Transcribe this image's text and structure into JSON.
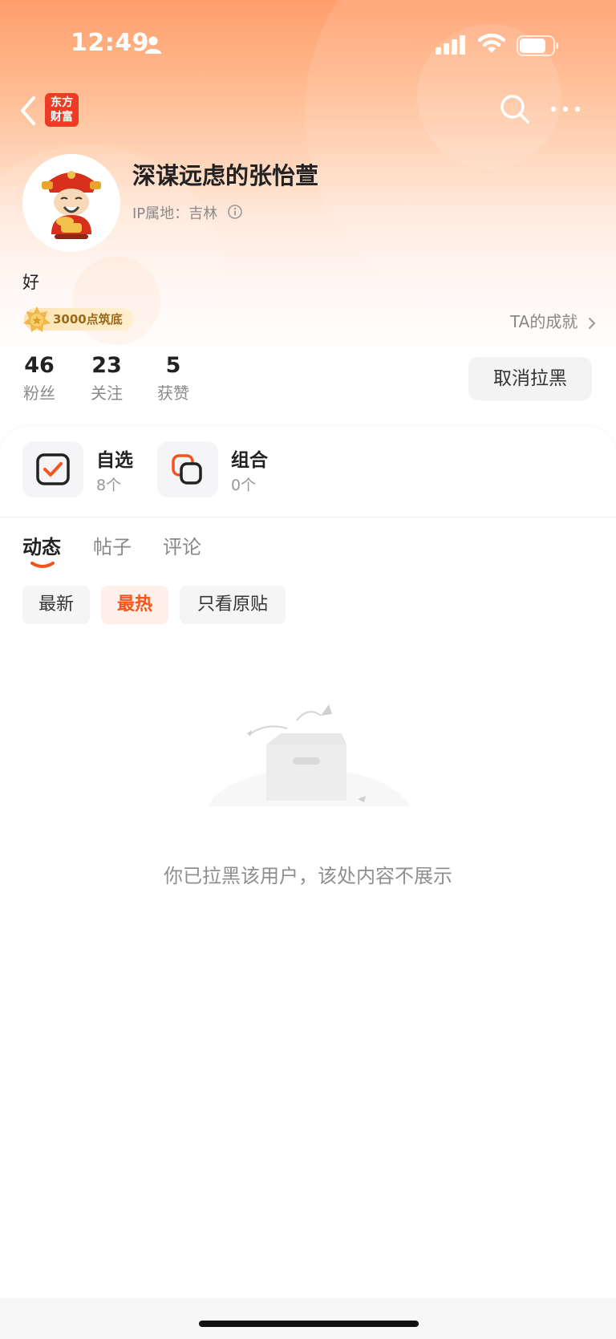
{
  "status_bar": {
    "time": "12:49"
  },
  "nav": {
    "logo_line1": "东方",
    "logo_line2": "财富"
  },
  "profile": {
    "username": "深谋远虑的张怡萱",
    "ip_location": "IP属地：吉林",
    "bio": "好",
    "badge": "3000点筑底",
    "achievement_link": "TA的成就",
    "stats": [
      {
        "value": "46",
        "label": "粉丝"
      },
      {
        "value": "23",
        "label": "关注"
      },
      {
        "value": "5",
        "label": "获赞"
      }
    ],
    "unblock_button": "取消拉黑"
  },
  "portfolio": [
    {
      "title": "自选",
      "count": "8个",
      "icon": "watchlist-icon"
    },
    {
      "title": "组合",
      "count": "0个",
      "icon": "portfolio-icon"
    }
  ],
  "tabs": [
    {
      "label": "动态",
      "active": true
    },
    {
      "label": "帖子",
      "active": false
    },
    {
      "label": "评论",
      "active": false
    }
  ],
  "filters": [
    {
      "label": "最新",
      "active": false
    },
    {
      "label": "最热",
      "active": true
    },
    {
      "label": "只看原贴",
      "active": false
    }
  ],
  "empty_state": {
    "message": "你已拉黑该用户，该处内容不展示"
  },
  "colors": {
    "accent": "#f4541d",
    "header_top": "#ff9e6b",
    "logo_red": "#ee3b24"
  }
}
